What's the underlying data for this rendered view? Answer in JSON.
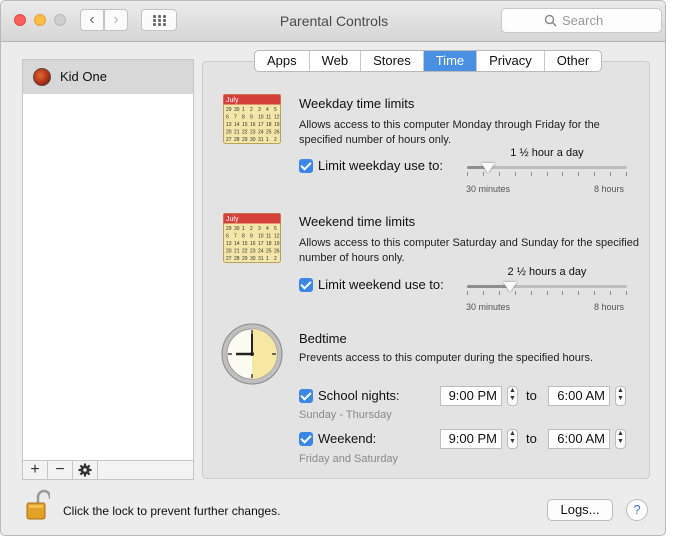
{
  "window": {
    "title": "Parental Controls"
  },
  "toolbar": {
    "search_placeholder": "Search"
  },
  "sidebar": {
    "users": [
      {
        "name": "Kid One"
      }
    ],
    "tools": {
      "add": "+",
      "remove": "−",
      "gear": "gear-icon"
    }
  },
  "tabs": [
    {
      "label": "Apps",
      "active": false
    },
    {
      "label": "Web",
      "active": false
    },
    {
      "label": "Stores",
      "active": false
    },
    {
      "label": "Time",
      "active": true
    },
    {
      "label": "Privacy",
      "active": false
    },
    {
      "label": "Other",
      "active": false
    }
  ],
  "weekday": {
    "calendar_month": "July",
    "title": "Weekday time limits",
    "description": "Allows access to this computer Monday through Friday for the specified number of hours only.",
    "checkbox_label": "Limit weekday use to:",
    "checked": true,
    "value_label": "1 ½ hour a day",
    "min_label": "30 minutes",
    "max_label": "8 hours",
    "value_fraction": 0.13
  },
  "weekend": {
    "calendar_month": "July",
    "title": "Weekend time limits",
    "description": "Allows access to this computer Saturday and Sunday for the specified number of hours only.",
    "checkbox_label": "Limit weekend use to:",
    "checked": true,
    "value_label": "2 ½ hours a day",
    "min_label": "30 minutes",
    "max_label": "8 hours",
    "value_fraction": 0.27
  },
  "bedtime": {
    "title": "Bedtime",
    "description": "Prevents access to this computer during the specified hours.",
    "school_nights": {
      "label": "School nights:",
      "checked": true,
      "from": "9:00 PM",
      "to_label": "to",
      "to": "6:00 AM",
      "sub": "Sunday - Thursday"
    },
    "weekend": {
      "label": "Weekend:",
      "checked": true,
      "from": "9:00 PM",
      "to_label": "to",
      "to": "6:00 AM",
      "sub": "Friday and Saturday"
    }
  },
  "footer": {
    "lock_text": "Click the lock to prevent further changes.",
    "logs_button": "Logs...",
    "help_button": "?"
  },
  "calendar_days": [
    "29",
    "30",
    "1",
    "2",
    "3",
    "4",
    "5",
    "6",
    "7",
    "8",
    "9",
    "10",
    "11",
    "12",
    "13",
    "14",
    "15",
    "16",
    "17",
    "18",
    "19",
    "20",
    "21",
    "22",
    "23",
    "24",
    "25",
    "26",
    "27",
    "28",
    "29",
    "30",
    "31",
    "1",
    "2"
  ],
  "colors": {
    "accent": "#3b86e6",
    "tab_active": "#4a90e2",
    "calendar_header": "#d6403a",
    "calendar_body": "#f2e6a8"
  }
}
